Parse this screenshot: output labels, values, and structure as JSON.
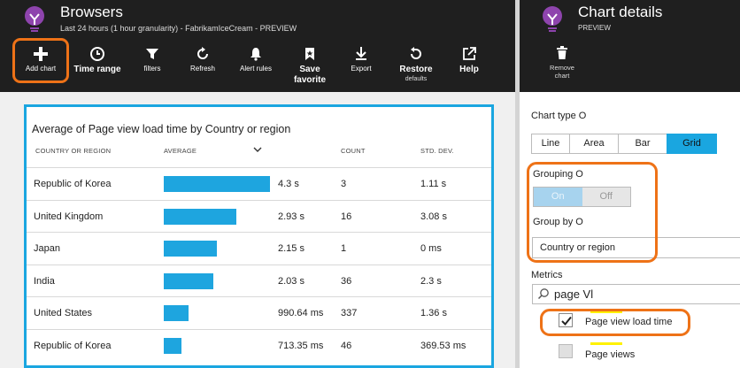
{
  "left_blade": {
    "title": "Browsers",
    "subtitle": "Last 24 hours (1 hour granularity) - FabrikamIceCream - PREVIEW",
    "toolbar": {
      "add_chart": "Add chart",
      "time_range": "Time range",
      "filters": "filters",
      "refresh": "Refresh",
      "alert_rules": "Alert rules",
      "save_favorite_1": "Save",
      "save_favorite_2": "favorite",
      "export": "Export",
      "restore": "Restore",
      "restore_sub": "defaults",
      "help": "Help"
    },
    "grid": {
      "title": "Average of Page view load time by Country or region",
      "columns": {
        "country": "COUNTRY OR REGION",
        "average": "AVERAGE",
        "count": "COUNT",
        "std": "STD. DEV."
      },
      "rows": [
        {
          "country": "Republic of Korea",
          "average": "4.3 s",
          "count": "3",
          "std": "1.11 s",
          "bar_fraction": 1.0
        },
        {
          "country": "United Kingdom",
          "average": "2.93 s",
          "count": "16",
          "std": "3.08 s",
          "bar_fraction": 0.68
        },
        {
          "country": "Japan",
          "average": "2.15 s",
          "count": "1",
          "std": "0 ms",
          "bar_fraction": 0.5
        },
        {
          "country": "India",
          "average": "2.03 s",
          "count": "36",
          "std": "2.3 s",
          "bar_fraction": 0.47
        },
        {
          "country": "United States",
          "average": "990.64 ms",
          "count": "337",
          "std": "1.36 s",
          "bar_fraction": 0.23
        },
        {
          "country": "Republic of Korea",
          "average": "713.35 ms",
          "count": "46",
          "std": "369.53 ms",
          "bar_fraction": 0.166
        }
      ]
    }
  },
  "right_blade": {
    "title": "Chart details",
    "subtitle": "PREVIEW",
    "remove_1": "Remove",
    "remove_2": "chart",
    "chart_type_label": "Chart type O",
    "chart_types": [
      "Line",
      "Area",
      "Bar",
      "Grid"
    ],
    "chart_type_selected": "Grid",
    "grouping_label": "Grouping O",
    "toggle_on": "On",
    "toggle_off": "Off",
    "group_by_label": "Group by O",
    "group_by_value": "Country or region",
    "metrics_label": "Metrics",
    "metrics_search": "page Vl",
    "metrics": [
      {
        "name": "Page view load time",
        "checked": true
      },
      {
        "name": "Page views",
        "checked": false
      }
    ]
  },
  "colors": {
    "accent": "#1aa6e0",
    "highlight": "#ee7217",
    "header_bg": "#1f1f1f"
  }
}
